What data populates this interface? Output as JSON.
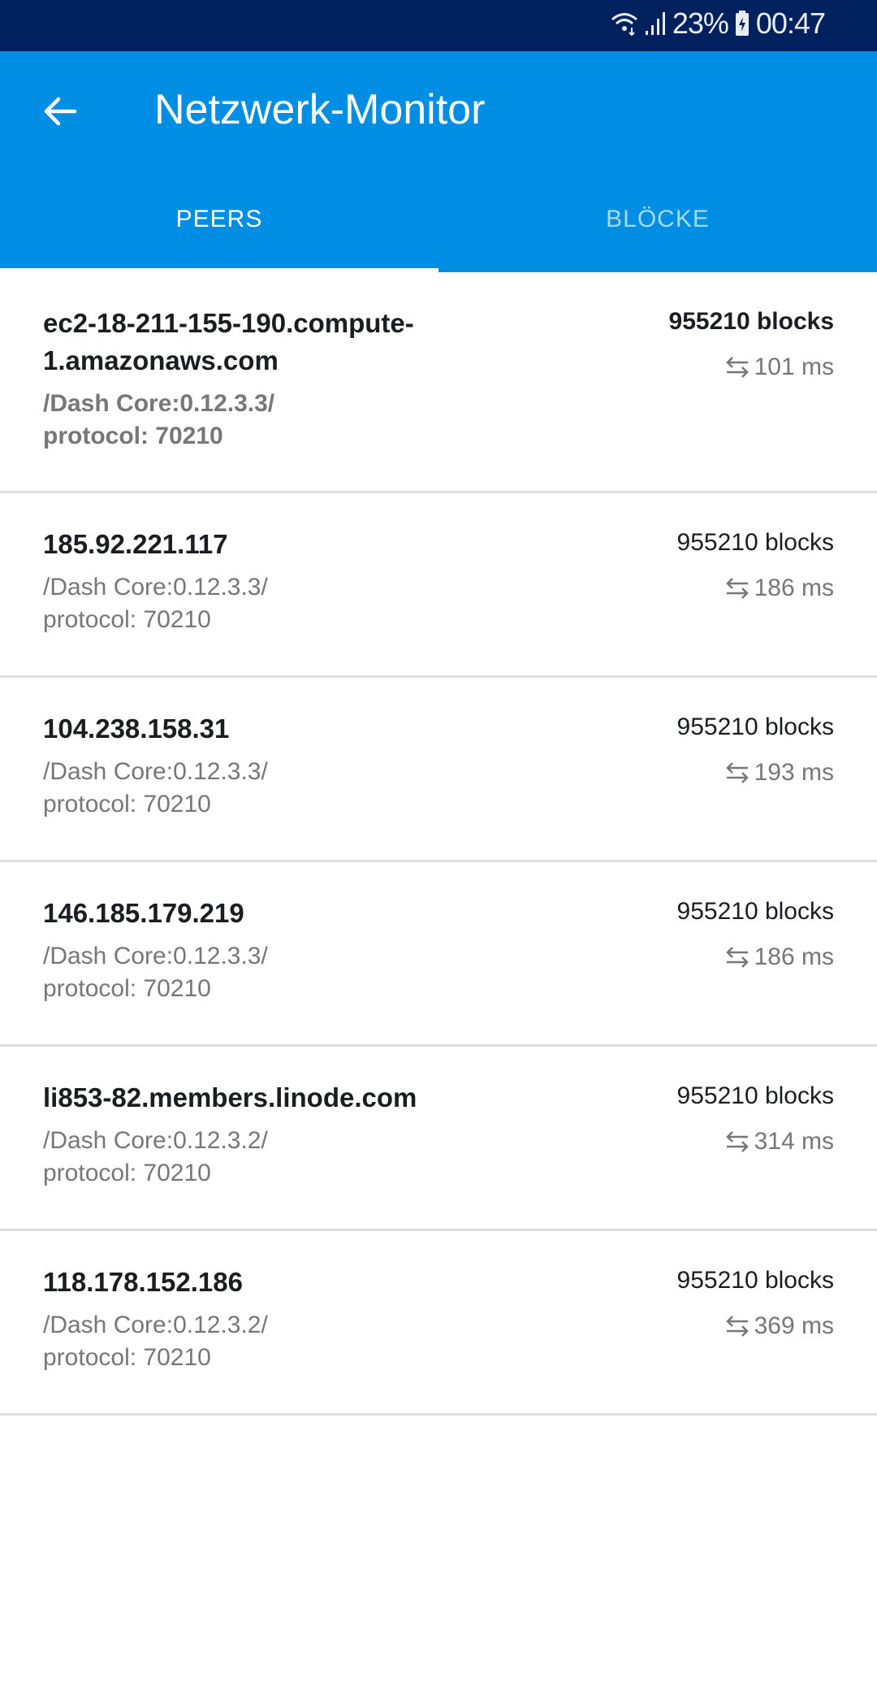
{
  "status_bar": {
    "battery": "23%",
    "time": "00:47",
    "icons": [
      "wifi-icon",
      "signal-icon",
      "battery-charging-icon"
    ]
  },
  "app_bar": {
    "title": "Netzwerk-Monitor",
    "back_icon": "arrow-left-icon"
  },
  "tabs": [
    {
      "label": "PEERS",
      "active": true
    },
    {
      "label": "BLÖCKE",
      "active": false
    }
  ],
  "colors": {
    "status_bar": "#00215e",
    "app_bar": "#008de4",
    "inactive_tab": "#a8d9f6"
  },
  "peers": [
    {
      "host": "ec2-18-211-155-190.compute-1.amazonaws.com",
      "version": "/Dash Core:0.12.3.3/",
      "protocol": "protocol: 70210",
      "blocks": "955210 blocks",
      "ping": "101 ms"
    },
    {
      "host": "185.92.221.117",
      "version": "/Dash Core:0.12.3.3/",
      "protocol": "protocol: 70210",
      "blocks": "955210 blocks",
      "ping": "186 ms"
    },
    {
      "host": "104.238.158.31",
      "version": "/Dash Core:0.12.3.3/",
      "protocol": "protocol: 70210",
      "blocks": "955210 blocks",
      "ping": "193 ms"
    },
    {
      "host": "146.185.179.219",
      "version": "/Dash Core:0.12.3.3/",
      "protocol": "protocol: 70210",
      "blocks": "955210 blocks",
      "ping": "186 ms"
    },
    {
      "host": "li853-82.members.linode.com",
      "version": "/Dash Core:0.12.3.2/",
      "protocol": "protocol: 70210",
      "blocks": "955210 blocks",
      "ping": "314 ms"
    },
    {
      "host": "118.178.152.186",
      "version": "/Dash Core:0.12.3.2/",
      "protocol": "protocol: 70210",
      "blocks": "955210 blocks",
      "ping": "369 ms"
    }
  ]
}
